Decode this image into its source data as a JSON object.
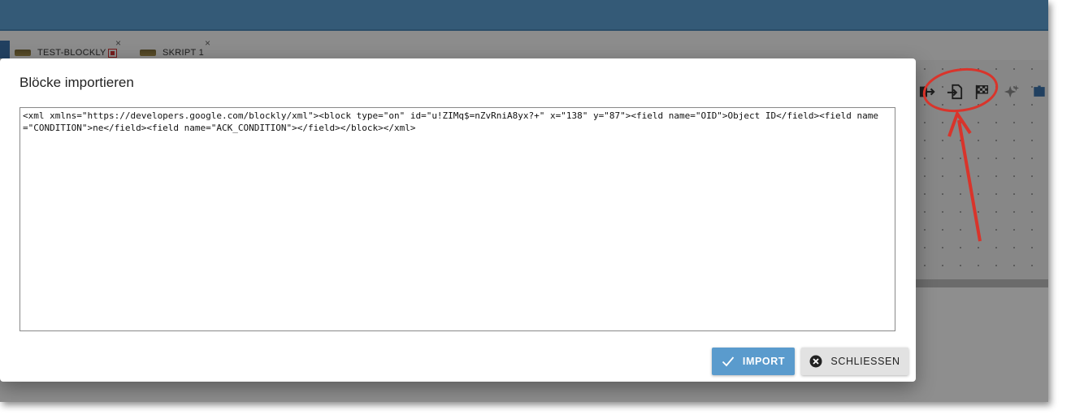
{
  "tabs": [
    {
      "label": "TEST-BLOCKLY",
      "close": "×"
    },
    {
      "label": "SKRIPT 1",
      "close": "×"
    }
  ],
  "dialog": {
    "title": "Blöcke importieren",
    "xml_value": "<xml xmlns=\"https://developers.google.com/blockly/xml\"><block type=\"on\" id=\"u!ZIMq$=nZvRniA8yx?+\" x=\"138\" y=\"87\"><field name=\"OID\">Object ID</field><field name=\"CONDITION\">ne</field><field name=\"ACK_CONDITION\"></field></block></xml>",
    "import_label": "IMPORT",
    "close_label": "SCHLIESSEN"
  },
  "colors": {
    "topbar": "#5a9bcd",
    "primary_button": "#5a9bcd",
    "annotation": "#d9342b"
  },
  "icons": [
    "export-blocks-icon",
    "import-blocks-icon",
    "checkered-flag-icon",
    "sparkle-icon",
    "puzzle-icon"
  ]
}
